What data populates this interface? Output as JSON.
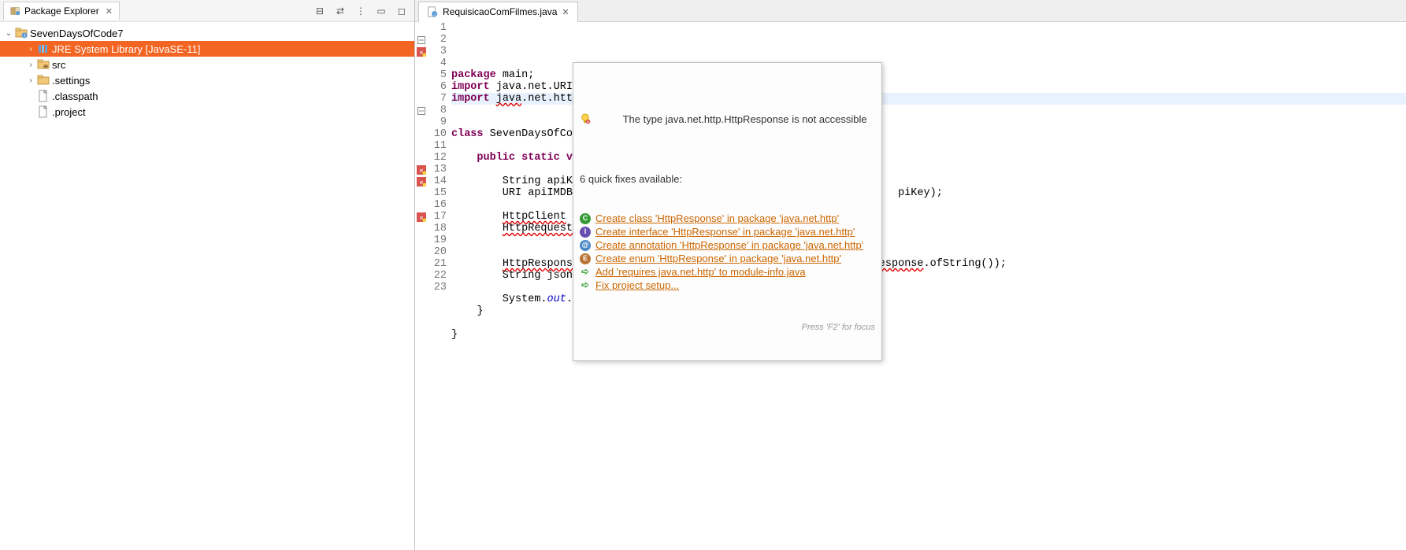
{
  "panel": {
    "title": "Package Explorer",
    "toolbar_icons": [
      "collapse-all-icon",
      "link-editor-icon",
      "view-menu-icon",
      "minimize-icon",
      "maximize-icon"
    ]
  },
  "tree": {
    "project": "SevenDaysOfCode7",
    "items": [
      {
        "label": "JRE System Library [JavaSE-11]",
        "icon": "library",
        "expandable": true,
        "selected": true,
        "indent": 1
      },
      {
        "label": "src",
        "icon": "package-folder",
        "expandable": true,
        "indent": 1
      },
      {
        "label": ".settings",
        "icon": "folder",
        "expandable": true,
        "indent": 1
      },
      {
        "label": ".classpath",
        "icon": "file",
        "expandable": false,
        "indent": 1
      },
      {
        "label": ".project",
        "icon": "file",
        "expandable": false,
        "indent": 1
      }
    ]
  },
  "editor": {
    "tab": "RequisicaoComFilmes.java"
  },
  "code_lines": [
    {
      "n": 1,
      "html": "<span class='kw'>package</span> main;"
    },
    {
      "n": 2,
      "html": "<span class='kw'>import</span> java.net.URI;",
      "fold": true
    },
    {
      "n": 3,
      "html": "<span class='kw'>import</span> <span class='err'>java</span>.net.http.HttpResponse;",
      "err": true,
      "hl": true
    },
    {
      "n": 4,
      "html": ""
    },
    {
      "n": 5,
      "html": ""
    },
    {
      "n": 6,
      "html": "<span class='kw'>class</span> SevenDaysOfCode "
    },
    {
      "n": 7,
      "html": ""
    },
    {
      "n": 8,
      "html": "    <span class='kw'>public</span> <span class='kw'>static</span> <span class='kw'>voi</span>",
      "fold": true
    },
    {
      "n": 9,
      "html": ""
    },
    {
      "n": 10,
      "html": "        String apiKey "
    },
    {
      "n": 11,
      "html": "        URI apiIMDB =                                                 piKey);"
    },
    {
      "n": 12,
      "html": ""
    },
    {
      "n": 13,
      "html": "        <span class='err'>HttpClient</span> cl",
      "err": true
    },
    {
      "n": 14,
      "html": "        <span class='err'>HttpRequest</span> r",
      "err": true
    },
    {
      "n": 15,
      "html": ""
    },
    {
      "n": 16,
      "html": ""
    },
    {
      "n": 17,
      "html": "        <span class='err'>HttpResponse</span>&lt;String&gt; response = cliente.send(request, <span class='err'>HttpResponse</span>.ofString());",
      "err": true
    },
    {
      "n": 18,
      "html": "        String json = response.body();"
    },
    {
      "n": 19,
      "html": ""
    },
    {
      "n": 20,
      "html": "        System.<span class='field'>out</span>.println(<span class='str'>\"Resposta: \"</span> + json);"
    },
    {
      "n": 21,
      "html": "    }"
    },
    {
      "n": 22,
      "html": ""
    },
    {
      "n": 23,
      "html": "}"
    }
  ],
  "tooltip": {
    "error_msg": "The type java.net.http.HttpResponse is not accessible",
    "fix_count": "6 quick fixes available:",
    "fixes": [
      {
        "icon": "C",
        "color": "#349a36",
        "text": "Create class 'HttpResponse' in package 'java.net.http'"
      },
      {
        "icon": "I",
        "color": "#6a4fb3",
        "text": "Create interface 'HttpResponse' in package 'java.net.http'"
      },
      {
        "icon": "@",
        "color": "#4a88c7",
        "text": "Create annotation 'HttpResponse' in package 'java.net.http'"
      },
      {
        "icon": "E",
        "color": "#b87333",
        "text": "Create enum 'HttpResponse' in package 'java.net.http'"
      },
      {
        "icon": "➪",
        "color": "#4aa84a",
        "text": "Add 'requires java.net.http' to module-info.java"
      },
      {
        "icon": "➪",
        "color": "#4aa84a",
        "text": "Fix project setup..."
      }
    ],
    "footer": "Press 'F2' for focus"
  }
}
